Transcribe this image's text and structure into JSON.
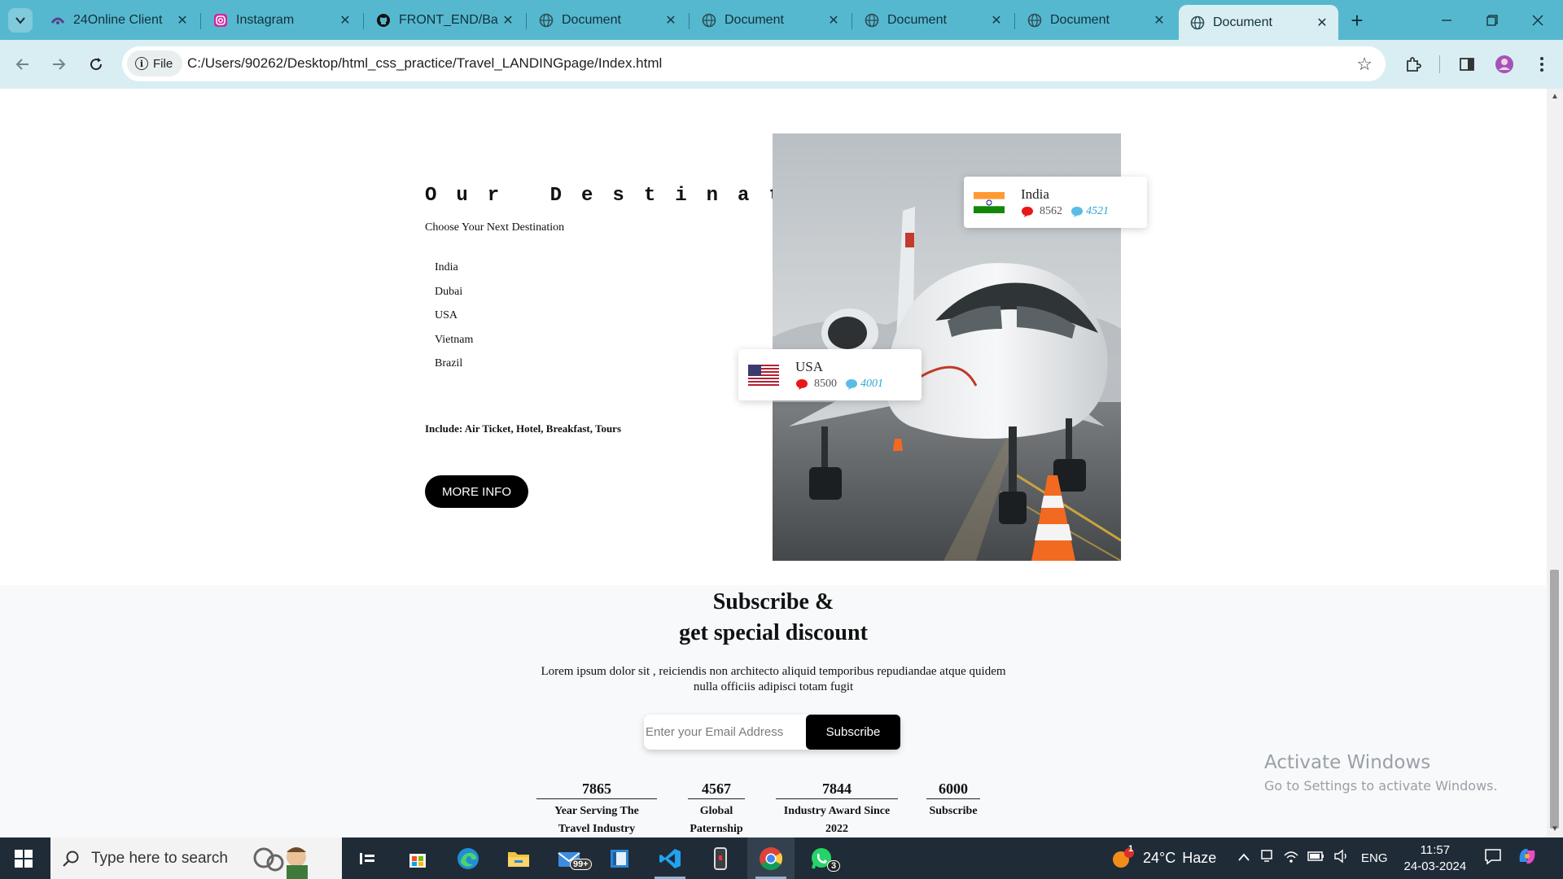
{
  "browser": {
    "tabs": [
      {
        "title": "24Online Client",
        "icon": "24online-icon"
      },
      {
        "title": "Instagram",
        "icon": "instagram-icon"
      },
      {
        "title": "FRONT_END/Ba",
        "icon": "github-icon"
      },
      {
        "title": "Document",
        "icon": "globe-icon"
      },
      {
        "title": "Document",
        "icon": "globe-icon"
      },
      {
        "title": "Document",
        "icon": "globe-icon"
      },
      {
        "title": "Document",
        "icon": "globe-icon"
      },
      {
        "title": "Document",
        "icon": "globe-icon",
        "active": true
      }
    ],
    "file_chip": "File",
    "url": "C:/Users/90262/Desktop/html_css_practice/Travel_LANDINGpage/Index.html",
    "accent_color": "#56b8cf",
    "toolbar_color": "#d9eef3"
  },
  "page": {
    "destination": {
      "title": "Our Destination",
      "subtitle": "Choose Your Next Destination",
      "list": [
        "India",
        "Dubai",
        "USA",
        "Vietnam",
        "Brazil"
      ],
      "include": "Include: Air Ticket, Hotel, Breakfast, Tours",
      "more_info": "MORE INFO"
    },
    "cards": {
      "india": {
        "country": "India",
        "likes": "8562",
        "comments": "4521"
      },
      "usa": {
        "country": "USA",
        "likes": "8500",
        "comments": "4001"
      }
    },
    "subscribe": {
      "title_line1": "Subscribe &",
      "title_line2": "get special discount",
      "para_line1": "Lorem ipsum dolor sit , reiciendis non architecto aliquid temporibus repudiandae atque quidem",
      "para_line2": "nulla officiis adipisci totam fugit",
      "email_placeholder": "Enter your Email Address",
      "button": "Subscribe"
    },
    "stats": [
      {
        "value": "7865",
        "label_line1": "Year Serving The",
        "label_line2": "Travel Industry"
      },
      {
        "value": "4567",
        "label_line1": "Global",
        "label_line2": "Paternship"
      },
      {
        "value": "7844",
        "label_line1": "Industry Award Since",
        "label_line2": "2022"
      },
      {
        "value": "6000",
        "label_line1": "Subscribe",
        "label_line2": ""
      }
    ],
    "watermark": {
      "line1": "Activate Windows",
      "line2": "Go to Settings to activate Windows."
    }
  },
  "taskbar": {
    "search_placeholder": "Type here to search",
    "mail_badge": "99+",
    "whatsapp_badge": "3",
    "weather_temp": "24°C",
    "weather_desc": "Haze",
    "weather_alert": "1",
    "language": "ENG",
    "time": "11:57",
    "date": "24-03-2024"
  }
}
